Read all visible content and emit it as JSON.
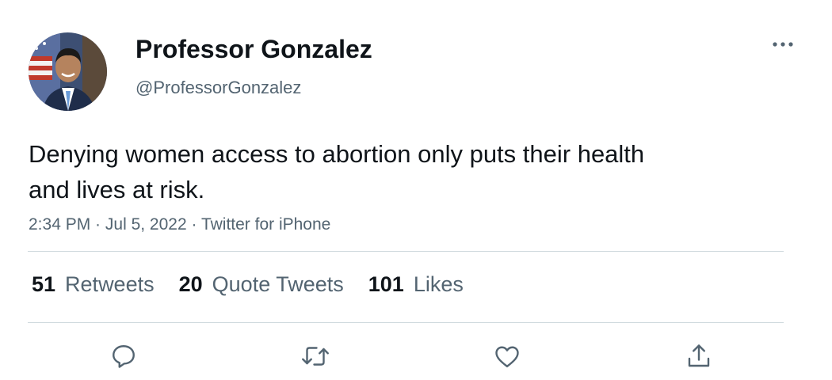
{
  "author": {
    "display_name": "Professor Gonzalez",
    "handle": "@ProfessorGonzalez",
    "avatar_icon": "profile-photo"
  },
  "tweet": {
    "text": "Denying women access to abortion only puts their health and lives at risk.",
    "time": "2:34 PM",
    "date": "Jul 5, 2022",
    "source": "Twitter for iPhone",
    "separator": " · "
  },
  "stats": {
    "retweets": {
      "count": "51",
      "label": "Retweets"
    },
    "quotes": {
      "count": "20",
      "label": "Quote Tweets"
    },
    "likes": {
      "count": "101",
      "label": "Likes"
    }
  },
  "actions": [
    "reply-icon",
    "retweet-icon",
    "like-icon",
    "share-icon"
  ],
  "colors": {
    "text": "#0f1419",
    "secondary": "#536471",
    "divider": "#cfd9de"
  }
}
